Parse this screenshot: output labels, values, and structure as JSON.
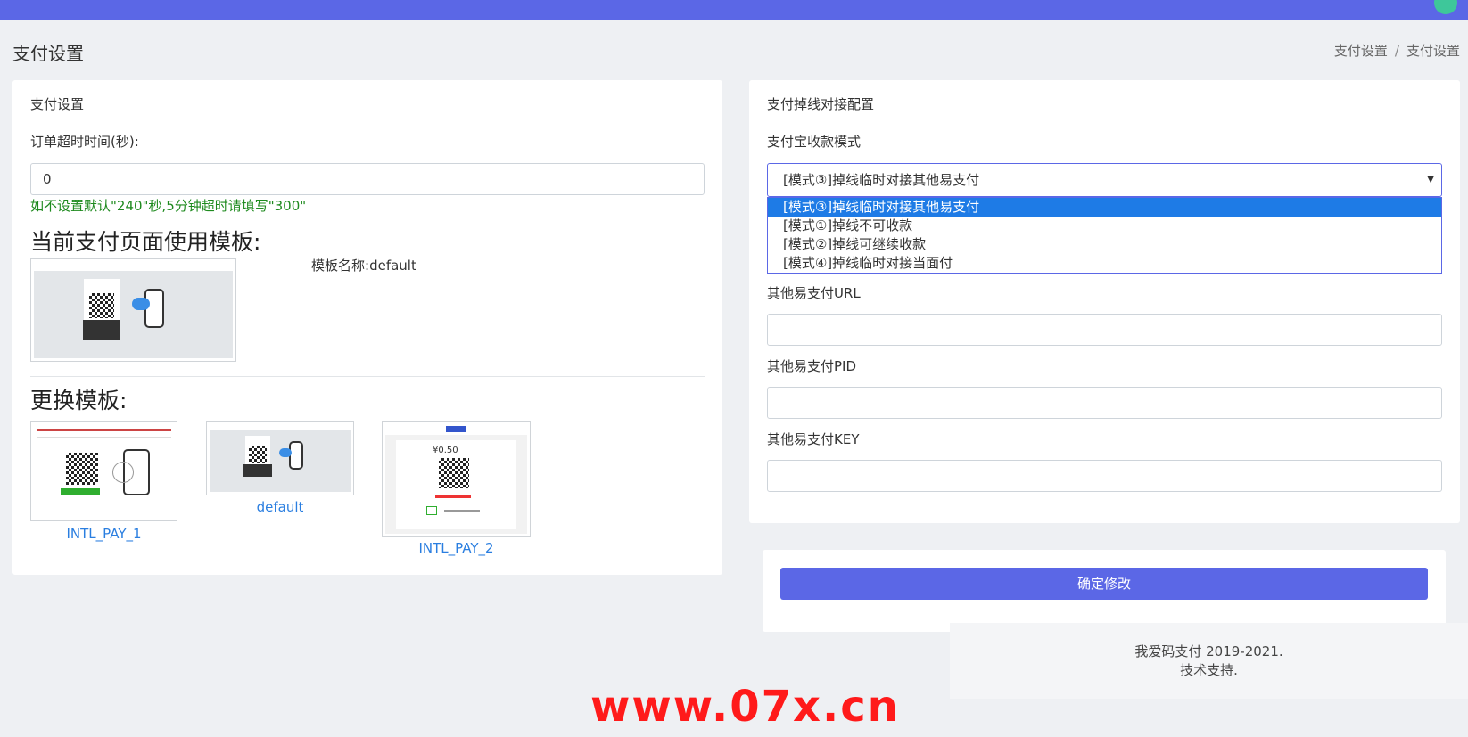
{
  "page": {
    "title": "支付设置",
    "breadcrumb": [
      "支付设置",
      "支付设置"
    ]
  },
  "left_card": {
    "title": "支付设置",
    "timeout_label": "订单超时时间(秒):",
    "timeout_value": "0",
    "timeout_hint": "如不设置默认\"240\"秒,5分钟超时请填写\"300\"",
    "current_template_heading": "当前支付页面使用模板:",
    "template_name_label": "模板名称:",
    "template_name_value": "default",
    "change_template_heading": "更换模板:",
    "templates": [
      {
        "name": "INTL_PAY_1"
      },
      {
        "name": "default"
      },
      {
        "name": "INTL_PAY_2",
        "price": "¥0.50"
      }
    ]
  },
  "right_card": {
    "title": "支付掉线对接配置",
    "alipay_mode_label": "支付宝收款模式",
    "alipay_mode_selected": "[模式③]掉线临时对接其他易支付",
    "alipay_mode_options": [
      "[模式③]掉线临时对接其他易支付",
      "[模式①]掉线不可收款",
      "[模式②]掉线可继续收款",
      "[模式④]掉线临时对接当面付"
    ],
    "other_url_label": "其他易支付URL",
    "other_url_value": "",
    "other_pid_label": "其他易支付PID",
    "other_pid_value": "",
    "other_key_label": "其他易支付KEY",
    "other_key_value": ""
  },
  "submit": {
    "label": "确定修改"
  },
  "footer": {
    "copyright": "我爱码支付 2019-2021.",
    "support": "技术支持."
  },
  "watermark": "www.07x.cn",
  "colors": {
    "accent": "#5b67e6",
    "hint_green": "#1e8a1e",
    "link_blue": "#2a7ee0",
    "selected_option": "#1e7be6",
    "watermark_red": "#ff1a1a"
  }
}
